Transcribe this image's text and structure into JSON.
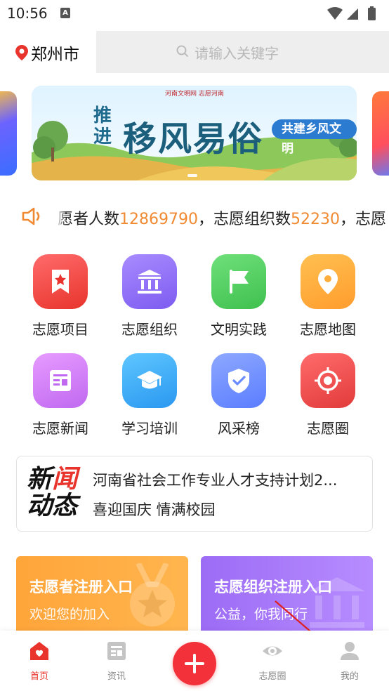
{
  "status_bar": {
    "time": "10:56",
    "notif_glyph": "A"
  },
  "header": {
    "city": "郑州市",
    "search_placeholder": "请输入关键字"
  },
  "banner": {
    "subtitle": "河南文明网  志愿河南",
    "title_small": "推进",
    "title_big": "移风易俗",
    "tag": "共建乡风文明"
  },
  "marquee": {
    "text1": "愿者人数",
    "num1": "12869790",
    "text2": "，志愿组织数",
    "num2": "52230",
    "text3": "，志愿"
  },
  "grid": [
    {
      "label": "志愿项目",
      "icon": "bookmark-icon",
      "color1": "#ff5d5d",
      "color2": "#e8342c"
    },
    {
      "label": "志愿组织",
      "icon": "building-icon",
      "color1": "#a88bff",
      "color2": "#7d5cf0"
    },
    {
      "label": "文明实践",
      "icon": "flag-icon",
      "color1": "#6fe07a",
      "color2": "#3fc04e"
    },
    {
      "label": "志愿地图",
      "icon": "map-pin-icon",
      "color1": "#ffc050",
      "color2": "#ff9d2e"
    },
    {
      "label": "志愿新闻",
      "icon": "newspaper-icon",
      "color1": "#e79bff",
      "color2": "#c069f0"
    },
    {
      "label": "学习培训",
      "icon": "graduation-cap-icon",
      "color1": "#5ec6ff",
      "color2": "#2a98f0"
    },
    {
      "label": "风采榜",
      "icon": "shield-check-icon",
      "color1": "#8ea8ff",
      "color2": "#5a7dff"
    },
    {
      "label": "志愿圈",
      "icon": "target-icon",
      "color1": "#ff6b6b",
      "color2": "#e23b3b"
    }
  ],
  "news": {
    "logo_line1a": "新",
    "logo_line1b": "闻",
    "logo_line2": "动态",
    "items": [
      "河南省社会工作专业人才支持计划2...",
      "喜迎国庆 情满校园"
    ]
  },
  "cards": [
    {
      "title": "志愿者注册入口",
      "subtitle": "欢迎您的加入"
    },
    {
      "title": "志愿组织注册入口",
      "subtitle": "公益，你我同行"
    }
  ],
  "tabbar": [
    {
      "label": "首页",
      "icon": "home-heart-icon",
      "active": true
    },
    {
      "label": "资讯",
      "icon": "news-icon",
      "active": false
    },
    {
      "label": "志愿圈",
      "icon": "eye-icon",
      "active": false
    },
    {
      "label": "我的",
      "icon": "user-icon",
      "active": false
    }
  ],
  "colors": {
    "accent": "#e8342c",
    "number": "#f08a32",
    "inactive": "#888888"
  }
}
